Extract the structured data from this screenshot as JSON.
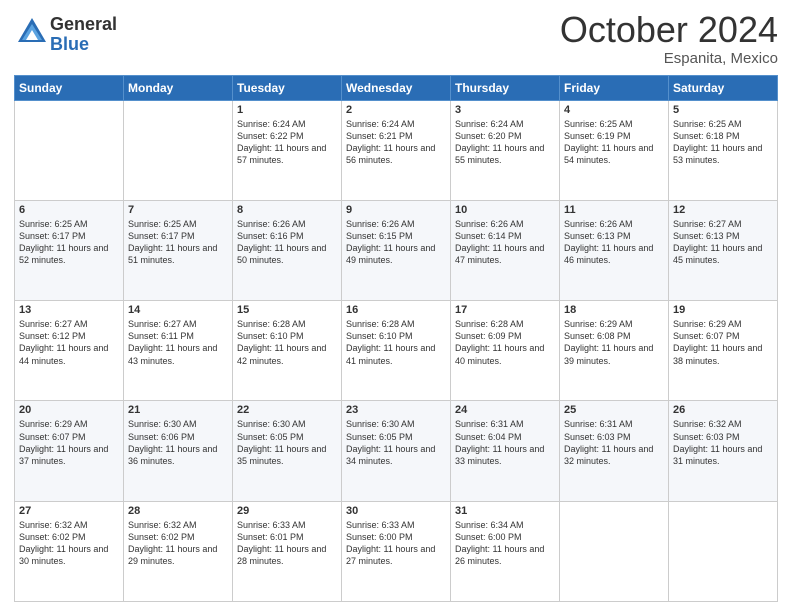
{
  "logo": {
    "general": "General",
    "blue": "Blue"
  },
  "header": {
    "month": "October 2024",
    "location": "Espanita, Mexico"
  },
  "weekdays": [
    "Sunday",
    "Monday",
    "Tuesday",
    "Wednesday",
    "Thursday",
    "Friday",
    "Saturday"
  ],
  "weeks": [
    [
      {
        "day": "",
        "sunrise": "",
        "sunset": "",
        "daylight": ""
      },
      {
        "day": "",
        "sunrise": "",
        "sunset": "",
        "daylight": ""
      },
      {
        "day": "1",
        "sunrise": "Sunrise: 6:24 AM",
        "sunset": "Sunset: 6:22 PM",
        "daylight": "Daylight: 11 hours and 57 minutes."
      },
      {
        "day": "2",
        "sunrise": "Sunrise: 6:24 AM",
        "sunset": "Sunset: 6:21 PM",
        "daylight": "Daylight: 11 hours and 56 minutes."
      },
      {
        "day": "3",
        "sunrise": "Sunrise: 6:24 AM",
        "sunset": "Sunset: 6:20 PM",
        "daylight": "Daylight: 11 hours and 55 minutes."
      },
      {
        "day": "4",
        "sunrise": "Sunrise: 6:25 AM",
        "sunset": "Sunset: 6:19 PM",
        "daylight": "Daylight: 11 hours and 54 minutes."
      },
      {
        "day": "5",
        "sunrise": "Sunrise: 6:25 AM",
        "sunset": "Sunset: 6:18 PM",
        "daylight": "Daylight: 11 hours and 53 minutes."
      }
    ],
    [
      {
        "day": "6",
        "sunrise": "Sunrise: 6:25 AM",
        "sunset": "Sunset: 6:17 PM",
        "daylight": "Daylight: 11 hours and 52 minutes."
      },
      {
        "day": "7",
        "sunrise": "Sunrise: 6:25 AM",
        "sunset": "Sunset: 6:17 PM",
        "daylight": "Daylight: 11 hours and 51 minutes."
      },
      {
        "day": "8",
        "sunrise": "Sunrise: 6:26 AM",
        "sunset": "Sunset: 6:16 PM",
        "daylight": "Daylight: 11 hours and 50 minutes."
      },
      {
        "day": "9",
        "sunrise": "Sunrise: 6:26 AM",
        "sunset": "Sunset: 6:15 PM",
        "daylight": "Daylight: 11 hours and 49 minutes."
      },
      {
        "day": "10",
        "sunrise": "Sunrise: 6:26 AM",
        "sunset": "Sunset: 6:14 PM",
        "daylight": "Daylight: 11 hours and 47 minutes."
      },
      {
        "day": "11",
        "sunrise": "Sunrise: 6:26 AM",
        "sunset": "Sunset: 6:13 PM",
        "daylight": "Daylight: 11 hours and 46 minutes."
      },
      {
        "day": "12",
        "sunrise": "Sunrise: 6:27 AM",
        "sunset": "Sunset: 6:13 PM",
        "daylight": "Daylight: 11 hours and 45 minutes."
      }
    ],
    [
      {
        "day": "13",
        "sunrise": "Sunrise: 6:27 AM",
        "sunset": "Sunset: 6:12 PM",
        "daylight": "Daylight: 11 hours and 44 minutes."
      },
      {
        "day": "14",
        "sunrise": "Sunrise: 6:27 AM",
        "sunset": "Sunset: 6:11 PM",
        "daylight": "Daylight: 11 hours and 43 minutes."
      },
      {
        "day": "15",
        "sunrise": "Sunrise: 6:28 AM",
        "sunset": "Sunset: 6:10 PM",
        "daylight": "Daylight: 11 hours and 42 minutes."
      },
      {
        "day": "16",
        "sunrise": "Sunrise: 6:28 AM",
        "sunset": "Sunset: 6:10 PM",
        "daylight": "Daylight: 11 hours and 41 minutes."
      },
      {
        "day": "17",
        "sunrise": "Sunrise: 6:28 AM",
        "sunset": "Sunset: 6:09 PM",
        "daylight": "Daylight: 11 hours and 40 minutes."
      },
      {
        "day": "18",
        "sunrise": "Sunrise: 6:29 AM",
        "sunset": "Sunset: 6:08 PM",
        "daylight": "Daylight: 11 hours and 39 minutes."
      },
      {
        "day": "19",
        "sunrise": "Sunrise: 6:29 AM",
        "sunset": "Sunset: 6:07 PM",
        "daylight": "Daylight: 11 hours and 38 minutes."
      }
    ],
    [
      {
        "day": "20",
        "sunrise": "Sunrise: 6:29 AM",
        "sunset": "Sunset: 6:07 PM",
        "daylight": "Daylight: 11 hours and 37 minutes."
      },
      {
        "day": "21",
        "sunrise": "Sunrise: 6:30 AM",
        "sunset": "Sunset: 6:06 PM",
        "daylight": "Daylight: 11 hours and 36 minutes."
      },
      {
        "day": "22",
        "sunrise": "Sunrise: 6:30 AM",
        "sunset": "Sunset: 6:05 PM",
        "daylight": "Daylight: 11 hours and 35 minutes."
      },
      {
        "day": "23",
        "sunrise": "Sunrise: 6:30 AM",
        "sunset": "Sunset: 6:05 PM",
        "daylight": "Daylight: 11 hours and 34 minutes."
      },
      {
        "day": "24",
        "sunrise": "Sunrise: 6:31 AM",
        "sunset": "Sunset: 6:04 PM",
        "daylight": "Daylight: 11 hours and 33 minutes."
      },
      {
        "day": "25",
        "sunrise": "Sunrise: 6:31 AM",
        "sunset": "Sunset: 6:03 PM",
        "daylight": "Daylight: 11 hours and 32 minutes."
      },
      {
        "day": "26",
        "sunrise": "Sunrise: 6:32 AM",
        "sunset": "Sunset: 6:03 PM",
        "daylight": "Daylight: 11 hours and 31 minutes."
      }
    ],
    [
      {
        "day": "27",
        "sunrise": "Sunrise: 6:32 AM",
        "sunset": "Sunset: 6:02 PM",
        "daylight": "Daylight: 11 hours and 30 minutes."
      },
      {
        "day": "28",
        "sunrise": "Sunrise: 6:32 AM",
        "sunset": "Sunset: 6:02 PM",
        "daylight": "Daylight: 11 hours and 29 minutes."
      },
      {
        "day": "29",
        "sunrise": "Sunrise: 6:33 AM",
        "sunset": "Sunset: 6:01 PM",
        "daylight": "Daylight: 11 hours and 28 minutes."
      },
      {
        "day": "30",
        "sunrise": "Sunrise: 6:33 AM",
        "sunset": "Sunset: 6:00 PM",
        "daylight": "Daylight: 11 hours and 27 minutes."
      },
      {
        "day": "31",
        "sunrise": "Sunrise: 6:34 AM",
        "sunset": "Sunset: 6:00 PM",
        "daylight": "Daylight: 11 hours and 26 minutes."
      },
      {
        "day": "",
        "sunrise": "",
        "sunset": "",
        "daylight": ""
      },
      {
        "day": "",
        "sunrise": "",
        "sunset": "",
        "daylight": ""
      }
    ]
  ]
}
